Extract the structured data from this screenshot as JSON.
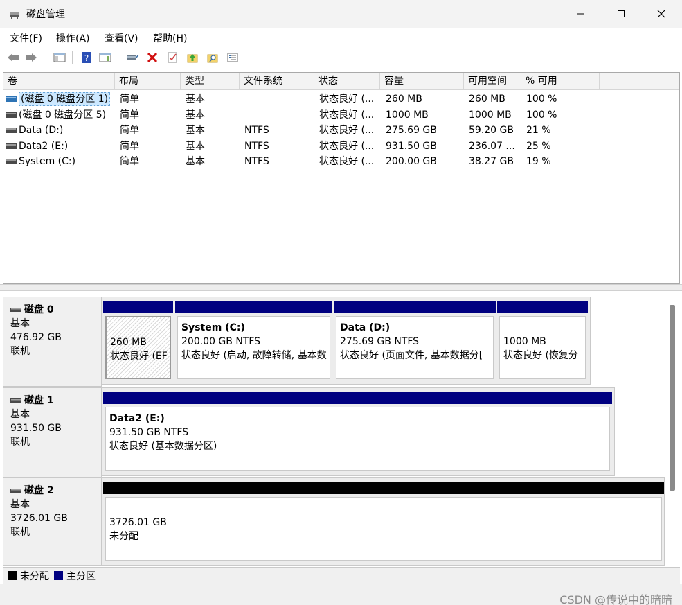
{
  "window": {
    "title": "磁盘管理"
  },
  "menu": [
    "文件(F)",
    "操作(A)",
    "查看(V)",
    "帮助(H)"
  ],
  "toolbar": {
    "buttons": [
      "back-icon",
      "forward-icon",
      "show-hide-console-tree-icon",
      "help-icon",
      "show-hide-action-pane-icon",
      "connect-disk-icon",
      "delete-icon",
      "checklist-icon",
      "up-folder-icon",
      "search-folder-icon",
      "properties-list-icon"
    ]
  },
  "volume_list": {
    "columns": [
      "卷",
      "布局",
      "类型",
      "文件系统",
      "状态",
      "容量",
      "可用空间",
      "% 可用"
    ],
    "rows": [
      {
        "volume": "(磁盘 0 磁盘分区 1)",
        "layout": "简单",
        "type": "基本",
        "fs": "",
        "status": "状态良好 (...",
        "capacity": "260 MB",
        "free": "260 MB",
        "pct": "100 %"
      },
      {
        "volume": "(磁盘 0 磁盘分区 5)",
        "layout": "简单",
        "type": "基本",
        "fs": "",
        "status": "状态良好 (...",
        "capacity": "1000 MB",
        "free": "1000 MB",
        "pct": "100 %"
      },
      {
        "volume": "Data (D:)",
        "layout": "简单",
        "type": "基本",
        "fs": "NTFS",
        "status": "状态良好 (...",
        "capacity": "275.69 GB",
        "free": "59.20 GB",
        "pct": "21 %"
      },
      {
        "volume": "Data2 (E:)",
        "layout": "简单",
        "type": "基本",
        "fs": "NTFS",
        "status": "状态良好 (...",
        "capacity": "931.50 GB",
        "free": "236.07 ...",
        "pct": "25 %"
      },
      {
        "volume": "System (C:)",
        "layout": "简单",
        "type": "基本",
        "fs": "NTFS",
        "status": "状态良好 (...",
        "capacity": "200.00 GB",
        "free": "38.27 GB",
        "pct": "19 %"
      }
    ]
  },
  "disks": [
    {
      "name": "磁盘 0",
      "type": "基本",
      "size": "476.92 GB",
      "state": "联机",
      "partitions": [
        {
          "name": "",
          "size_fs": "260 MB",
          "status": "状态良好 (EF",
          "bar": "primary",
          "selected": true
        },
        {
          "name": "System  (C:)",
          "size_fs": "200.00 GB NTFS",
          "status": "状态良好 (启动, 故障转储, 基本数",
          "bar": "primary"
        },
        {
          "name": "Data  (D:)",
          "size_fs": "275.69 GB NTFS",
          "status": "状态良好 (页面文件, 基本数据分[",
          "bar": "primary"
        },
        {
          "name": "",
          "size_fs": "1000 MB",
          "status": "状态良好 (恢复分",
          "bar": "primary"
        }
      ]
    },
    {
      "name": "磁盘 1",
      "type": "基本",
      "size": "931.50 GB",
      "state": "联机",
      "partitions": [
        {
          "name": "Data2  (E:)",
          "size_fs": "931.50 GB NTFS",
          "status": "状态良好 (基本数据分区)",
          "bar": "primary"
        }
      ]
    },
    {
      "name": "磁盘 2",
      "type": "基本",
      "size": "3726.01 GB",
      "state": "联机",
      "partitions": [
        {
          "name": "",
          "size_fs": "3726.01 GB",
          "status": "未分配",
          "bar": "unallocated"
        }
      ]
    }
  ],
  "legend": [
    {
      "label": "未分配",
      "color": "#000000"
    },
    {
      "label": "主分区",
      "color": "#000080"
    }
  ],
  "colors": {
    "primary": "#000080",
    "unallocated": "#000000",
    "selected_row": "#cce8ff"
  },
  "watermark": "CSDN @传说中的暗暗"
}
